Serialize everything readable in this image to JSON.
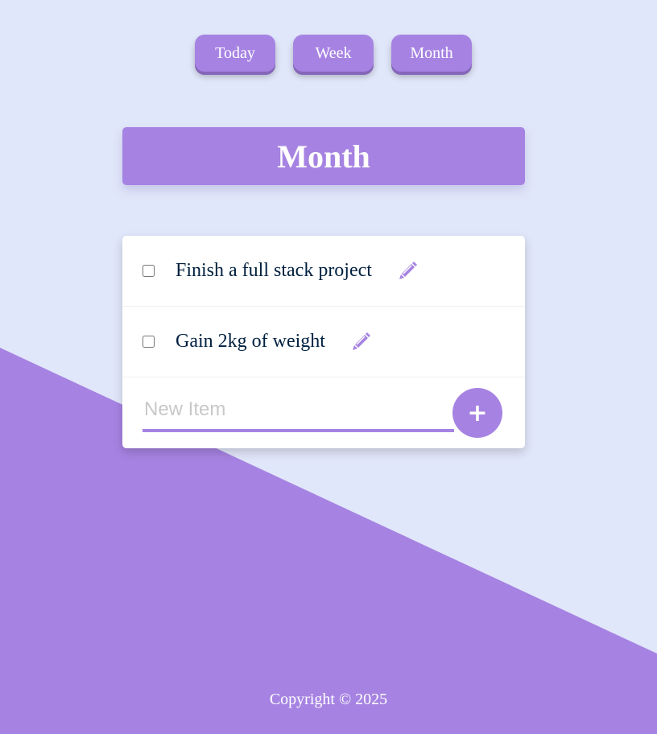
{
  "colors": {
    "page_background": "#e1e7fa",
    "accent": "#a683e2",
    "item_text": "#00203f"
  },
  "nav": {
    "buttons": [
      {
        "label": "Today"
      },
      {
        "label": "Week"
      },
      {
        "label": "Month"
      }
    ]
  },
  "list": {
    "title": "Month",
    "items": [
      {
        "text": "Finish a full stack project",
        "checked": false,
        "icon": "pencil-icon"
      },
      {
        "text": "Gain 2kg of weight",
        "checked": false,
        "icon": "pencil-icon"
      }
    ],
    "new_item": {
      "placeholder": "New Item",
      "value": ""
    },
    "add_button_label": "+"
  },
  "footer": {
    "text": "Copyright © 2025"
  }
}
